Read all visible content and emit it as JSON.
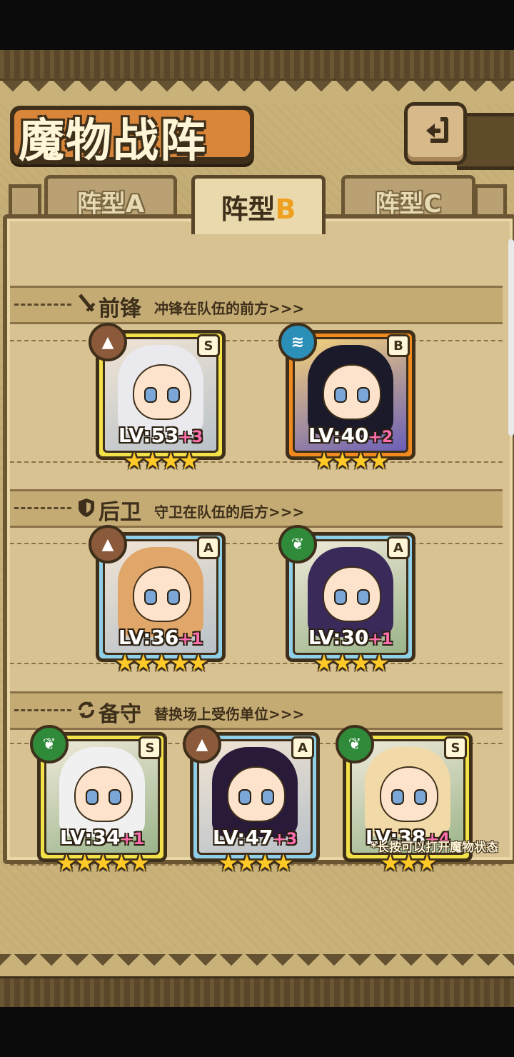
{
  "title": "魔物战阵",
  "back_icon": "back-arrow-icon",
  "tabs": [
    {
      "prefix": "阵型",
      "letter": "A",
      "active": false
    },
    {
      "prefix": "阵型",
      "letter": "B",
      "active": true
    },
    {
      "prefix": "阵型",
      "letter": "C",
      "active": false
    }
  ],
  "sections": [
    {
      "icon": "sword-icon",
      "title": "前锋",
      "desc": "冲锋在队伍的前方>>>"
    },
    {
      "icon": "shield-icon",
      "title": "后卫",
      "desc": "守卫在队伍的后方>>>"
    },
    {
      "icon": "swap-icon",
      "title": "备守",
      "desc": "替换场上受伤单位>>>"
    }
  ],
  "cards": {
    "vanguard": [
      {
        "rank": "S",
        "lv": "LV:53",
        "plus": "+3",
        "stars": 4,
        "element": "earth",
        "frame": "yellow"
      },
      {
        "rank": "B",
        "lv": "LV:40",
        "plus": "+2",
        "stars": 4,
        "element": "water",
        "frame": "orange"
      }
    ],
    "rearguard": [
      {
        "rank": "A",
        "lv": "LV:36",
        "plus": "+1",
        "stars": 5,
        "element": "earth",
        "frame": "blue"
      },
      {
        "rank": "A",
        "lv": "LV:30",
        "plus": "+1",
        "stars": 4,
        "element": "wood",
        "frame": "blue"
      }
    ],
    "reserve": [
      {
        "rank": "S",
        "lv": "LV:34",
        "plus": "+1",
        "stars": 5,
        "element": "wood",
        "frame": "yellow"
      },
      {
        "rank": "A",
        "lv": "LV:47",
        "plus": "+3",
        "stars": 4,
        "element": "earth",
        "frame": "blue"
      },
      {
        "rank": "S",
        "lv": "LV:38",
        "plus": "+4",
        "stars": 3,
        "element": "wood",
        "frame": "yellow"
      }
    ]
  },
  "hint": "*长按可以打开魔物状态",
  "colors": {
    "yellow_frame": "#f3e14a",
    "orange_frame": "#f08a1e",
    "blue_frame": "#8fd0e8",
    "plus_level": "#ff6fb0",
    "star": "#ffc928"
  }
}
